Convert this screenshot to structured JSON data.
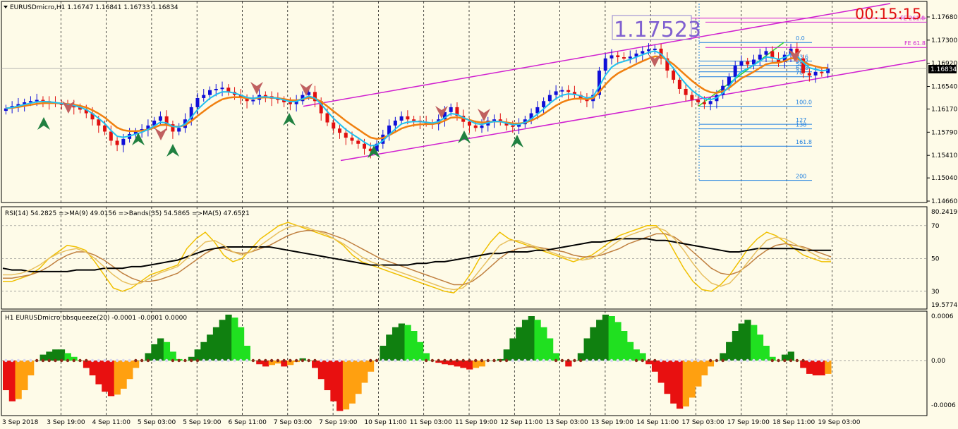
{
  "panels": {
    "main": {
      "header": "EURUSDmicro,H1  1.16747 1.16841 1.16733 1.16834",
      "price_tag": "1.16834",
      "big_price": "1.17523",
      "timer": "00:15:15",
      "fe_labels": [
        "FE 261.8",
        "FE 61.8"
      ],
      "fib_labels": [
        "138",
        "161.8",
        "0.0",
        "23.6",
        "38.2",
        "50.0",
        "61.8",
        "78",
        "100.0",
        "127",
        "138",
        "161.8",
        "200"
      ]
    },
    "rsi": {
      "header": "RSI(14) 54.2825  =>MA(9) 49.0156  =>Bands(35) 54.5865  =>MA(5) 47.6521",
      "levels": [
        "70",
        "50",
        "30"
      ],
      "top_label": "80.2419",
      "bottom_label": "19.5774"
    },
    "squeeze": {
      "header": "H1 EURUSDmicro bbsqueeze(20) -0.0001 -0.0001 0.0000",
      "levels": [
        "0.0006",
        "0.00",
        "-0.0006"
      ]
    }
  },
  "colors": {
    "background": "#fefbe8",
    "bull": "#1010d8",
    "bear": "#e01010",
    "channel": "#d020d0",
    "fib": "#2080e0",
    "ema_fast": "#20c0f0",
    "ema_slow": "#f08010",
    "rsi": "#f0c000",
    "rsi_ma": "#c08040",
    "rsi_bands": "#000000",
    "sq_pos_dark": "#108010",
    "sq_pos_light": "#20e020",
    "sq_neg_dark": "#e81010",
    "sq_neg_light": "#ffa010",
    "timer": "#e01010",
    "big_price": "#8060d0"
  },
  "chart_data": [
    {
      "type": "line",
      "title": "EURUSDmicro,H1",
      "price_axis_labels": [
        "1.17680",
        "1.17300",
        "1.16920",
        "1.16540",
        "1.16170",
        "1.15790",
        "1.15410",
        "1.15040",
        "1.14660"
      ],
      "ylim": [
        1.1466,
        1.179
      ],
      "time_labels": [
        "3 Sep 2018",
        "3 Sep 19:00",
        "4 Sep 11:00",
        "5 Sep 03:00",
        "5 Sep 19:00",
        "6 Sep 11:00",
        "7 Sep 03:00",
        "7 Sep 19:00",
        "10 Sep 11:00",
        "11 Sep 03:00",
        "11 Sep 19:00",
        "12 Sep 11:00",
        "13 Sep 03:00",
        "13 Sep 19:00",
        "14 Sep 11:00",
        "17 Sep 03:00",
        "17 Sep 19:00",
        "18 Sep 11:00",
        "19 Sep 03:00"
      ],
      "close": [
        1.1618,
        1.1622,
        1.1625,
        1.1628,
        1.163,
        1.1632,
        1.163,
        1.1628,
        1.1626,
        1.1624,
        1.1622,
        1.162,
        1.1616,
        1.161,
        1.16,
        1.159,
        1.158,
        1.1565,
        1.1558,
        1.1568,
        1.1576,
        1.158,
        1.1584,
        1.159,
        1.1598,
        1.1605,
        1.1592,
        1.158,
        1.1586,
        1.16,
        1.162,
        1.1635,
        1.164,
        1.1648,
        1.165,
        1.1652,
        1.1645,
        1.164,
        1.1635,
        1.163,
        1.1632,
        1.164,
        1.1638,
        1.1634,
        1.1632,
        1.1628,
        1.1625,
        1.163,
        1.164,
        1.1645,
        1.163,
        1.161,
        1.1595,
        1.1585,
        1.1578,
        1.157,
        1.1565,
        1.156,
        1.1552,
        1.1548,
        1.156,
        1.1575,
        1.159,
        1.1598,
        1.1605,
        1.16,
        1.1598,
        1.1596,
        1.1594,
        1.1592,
        1.16,
        1.1612,
        1.162,
        1.1606,
        1.1596,
        1.159,
        1.1586,
        1.159,
        1.1598,
        1.16,
        1.1596,
        1.159,
        1.1588,
        1.1592,
        1.16,
        1.161,
        1.162,
        1.163,
        1.164,
        1.1646,
        1.1648,
        1.1645,
        1.164,
        1.1635,
        1.163,
        1.164,
        1.168,
        1.17,
        1.1705,
        1.1702,
        1.17,
        1.1703,
        1.1708,
        1.1712,
        1.1715,
        1.1716,
        1.17,
        1.168,
        1.1665,
        1.165,
        1.164,
        1.1632,
        1.1628,
        1.1625,
        1.163,
        1.164,
        1.1655,
        1.167,
        1.1688,
        1.1695,
        1.169,
        1.1698,
        1.1706,
        1.1712,
        1.17,
        1.1694,
        1.1706,
        1.1716,
        1.17,
        1.1676,
        1.1672,
        1.1678,
        1.1676,
        1.1683
      ],
      "fib_retracement": {
        "0.0": 1.17261,
        "23.6": 1.16956,
        "38.2": 1.16885,
        "50.0": 1.16835,
        "61.8": 1.1678,
        "78": 1.167,
        "100.0": 1.16215,
        "127": 1.1592,
        "138": 1.15845,
        "161.8": 1.1556,
        "200": 1.15
      }
    },
    {
      "type": "line",
      "title": "RSI(14)",
      "ylim": [
        19.5774,
        80.2419
      ],
      "levels": [
        30,
        50,
        70
      ],
      "series": [
        {
          "name": "RSI(14)",
          "values": [
            36,
            36,
            38,
            40,
            44,
            50,
            54,
            58,
            57,
            55,
            48,
            40,
            32,
            30,
            32,
            36,
            40,
            42,
            44,
            46,
            56,
            62,
            66,
            60,
            52,
            48,
            50,
            56,
            62,
            66,
            70,
            72,
            70,
            68,
            66,
            64,
            62,
            58,
            52,
            48,
            46,
            44,
            42,
            40,
            38,
            36,
            34,
            32,
            30,
            29,
            34,
            42,
            52,
            60,
            66,
            62,
            60,
            58,
            56,
            54,
            52,
            50,
            48,
            50,
            52,
            56,
            60,
            64,
            66,
            68,
            70,
            70,
            64,
            54,
            44,
            36,
            31,
            30,
            34,
            40,
            48,
            56,
            62,
            66,
            64,
            60,
            56,
            52,
            50,
            48,
            48
          ]
        },
        {
          "name": "MA(9)",
          "values": [
            38,
            38,
            39,
            40,
            42,
            45,
            49,
            52,
            54,
            54,
            52,
            49,
            45,
            41,
            38,
            36,
            36,
            37,
            39,
            41,
            45,
            49,
            53,
            56,
            56,
            54,
            53,
            54,
            56,
            58,
            61,
            64,
            66,
            67,
            67,
            66,
            64,
            62,
            59,
            56,
            53,
            50,
            48,
            46,
            44,
            42,
            40,
            38,
            36,
            34,
            34,
            36,
            40,
            45,
            50,
            54,
            56,
            57,
            57,
            56,
            55,
            54,
            52,
            51,
            51,
            52,
            54,
            56,
            59,
            61,
            63,
            65,
            65,
            63,
            59,
            54,
            49,
            44,
            41,
            40,
            42,
            46,
            51,
            55,
            58,
            59,
            58,
            57,
            55,
            53,
            51
          ]
        },
        {
          "name": "Bands(35)",
          "values": [
            44,
            43,
            43,
            42,
            42,
            42,
            42,
            42,
            43,
            43,
            43,
            44,
            44,
            44,
            45,
            45,
            46,
            47,
            48,
            49,
            51,
            53,
            55,
            56,
            57,
            57,
            57,
            57,
            57,
            57,
            56,
            55,
            54,
            53,
            52,
            51,
            50,
            49,
            48,
            47,
            46,
            46,
            46,
            46,
            46,
            47,
            47,
            48,
            48,
            49,
            50,
            51,
            52,
            53,
            53,
            54,
            54,
            54,
            55,
            55,
            56,
            57,
            58,
            59,
            60,
            60,
            61,
            62,
            62,
            62,
            62,
            61,
            61,
            60,
            59,
            58,
            57,
            56,
            55,
            54,
            54,
            55,
            56,
            56,
            56,
            56,
            56,
            55,
            55,
            55,
            55
          ]
        },
        {
          "name": "MA(5)",
          "values": [
            40,
            40,
            41,
            43,
            46,
            50,
            53,
            55,
            56,
            54,
            50,
            45,
            40,
            36,
            34,
            35,
            38,
            41,
            43,
            45,
            50,
            55,
            60,
            61,
            58,
            54,
            52,
            54,
            58,
            62,
            66,
            69,
            70,
            69,
            67,
            65,
            62,
            59,
            55,
            51,
            48,
            46,
            44,
            42,
            40,
            38,
            36,
            34,
            32,
            31,
            32,
            37,
            44,
            51,
            58,
            61,
            61,
            59,
            57,
            55,
            53,
            51,
            50,
            49,
            50,
            53,
            57,
            61,
            64,
            66,
            68,
            69,
            67,
            62,
            55,
            47,
            40,
            35,
            33,
            35,
            41,
            48,
            55,
            61,
            63,
            62,
            59,
            56,
            53,
            50,
            49
          ]
        }
      ]
    },
    {
      "type": "bar",
      "title": "bbsqueeze(20)",
      "ylim": [
        -0.0006,
        0.0006
      ],
      "values": [
        -0.0004,
        -0.00055,
        -0.00052,
        -0.0004,
        -0.0002,
        0.0,
        8e-05,
        0.00012,
        0.00015,
        0.00015,
        0.0001,
        5e-05,
        0.0,
        -0.0001,
        -0.0002,
        -0.00032,
        -0.00042,
        -0.00048,
        -0.00046,
        -0.00038,
        -0.00025,
        -0.0001,
        0.0,
        0.0001,
        0.00022,
        0.0003,
        0.00025,
        0.00012,
        2e-05,
        0.0,
        5e-05,
        0.00015,
        0.00025,
        0.00035,
        0.00045,
        0.00055,
        0.00062,
        0.00058,
        0.00045,
        0.0002,
        0.0,
        -5e-05,
        -8e-05,
        -6e-05,
        -4e-05,
        -8e-05,
        -6e-05,
        -2e-05,
        3e-05,
        0.0,
        -0.0001,
        -0.00025,
        -0.0004,
        -0.00055,
        -0.00068,
        -0.00066,
        -0.00058,
        -0.00045,
        -0.0003,
        -0.00015,
        0.0,
        0.0002,
        0.00035,
        0.00045,
        0.0005,
        0.00048,
        0.0004,
        0.00025,
        0.0001,
        0.0,
        -3e-05,
        -5e-05,
        -6e-05,
        -8e-05,
        -0.0001,
        -0.00012,
        -0.0001,
        -8e-05,
        0.0,
        0.0,
        2e-05,
        0.00015,
        0.0003,
        0.00045,
        0.00055,
        0.0006,
        0.00055,
        0.00045,
        0.0003,
        0.0001,
        0.0,
        -8e-05,
        0.0,
        0.0001,
        0.0003,
        0.00045,
        0.00055,
        0.00062,
        0.0006,
        0.00052,
        0.0004,
        0.00025,
        0.00015,
        0.0001,
        -5e-05,
        -0.00015,
        -0.0003,
        -0.00045,
        -0.00058,
        -0.00065,
        -0.00062,
        -0.0005,
        -0.00035,
        -0.0002,
        -8e-05,
        0.0,
        0.0001,
        0.00025,
        0.0004,
        0.0005,
        0.00055,
        0.00048,
        0.00035,
        0.0002,
        5e-05,
        0.0,
        8e-05,
        0.00012,
        0.0,
        -0.0001,
        -0.00018,
        -0.0002,
        -0.0002,
        -0.00018
      ]
    }
  ]
}
